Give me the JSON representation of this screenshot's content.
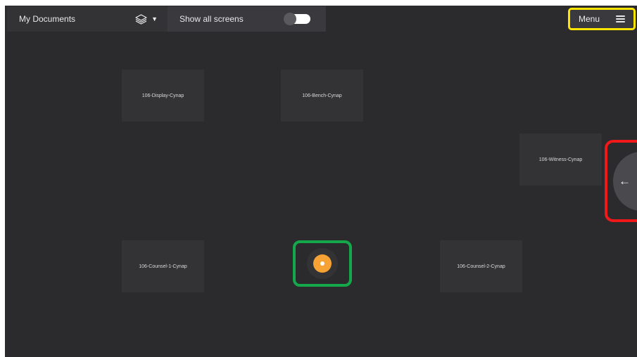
{
  "topbar": {
    "documents_label": "My Documents",
    "layers_icon": "layers-icon",
    "show_all_label": "Show all screens",
    "show_all_enabled": false
  },
  "menu": {
    "label": "Menu",
    "icon": "hamburger-icon",
    "highlight_color": "#ffe600"
  },
  "screens": [
    "106-Display-Cynap",
    "106-Bench-Cynap",
    "106-Witness-Cynap",
    "106-Counsel-1-Cynap",
    "106-Counsel-2-Cynap"
  ],
  "target": {
    "icon": "location-target-icon",
    "color": "#f7a234",
    "highlight_color": "#14a84a"
  },
  "back": {
    "glyph": "←",
    "icon": "arrow-left-icon",
    "highlight_color": "#f01818"
  }
}
